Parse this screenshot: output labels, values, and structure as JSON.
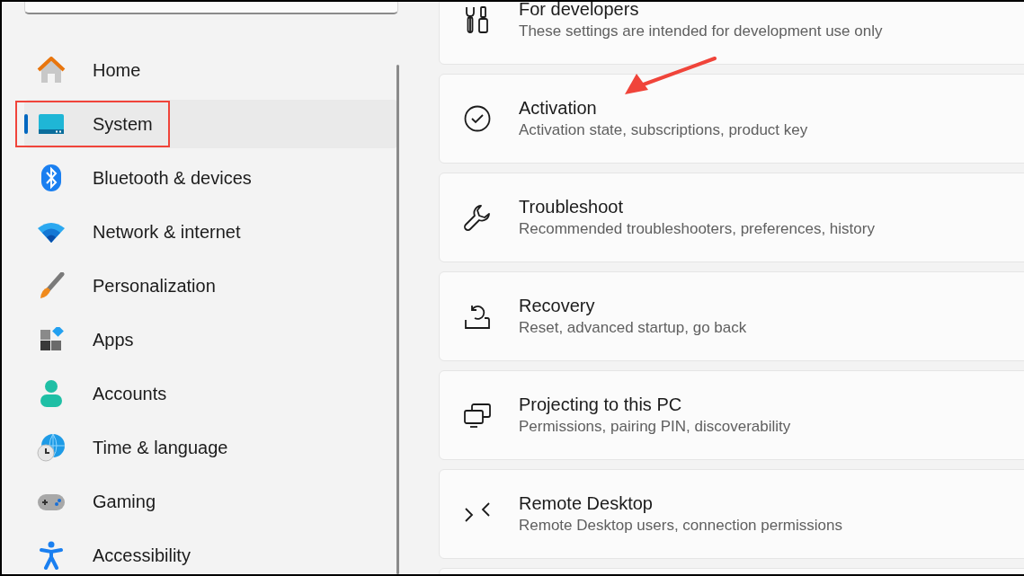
{
  "sidebar": {
    "items": [
      {
        "label": "Home",
        "selected": false,
        "highlighted": false
      },
      {
        "label": "System",
        "selected": true,
        "highlighted": true
      },
      {
        "label": "Bluetooth & devices",
        "selected": false,
        "highlighted": false
      },
      {
        "label": "Network & internet",
        "selected": false,
        "highlighted": false
      },
      {
        "label": "Personalization",
        "selected": false,
        "highlighted": false
      },
      {
        "label": "Apps",
        "selected": false,
        "highlighted": false
      },
      {
        "label": "Accounts",
        "selected": false,
        "highlighted": false
      },
      {
        "label": "Time & language",
        "selected": false,
        "highlighted": false
      },
      {
        "label": "Gaming",
        "selected": false,
        "highlighted": false
      },
      {
        "label": "Accessibility",
        "selected": false,
        "highlighted": false
      }
    ]
  },
  "cards": [
    {
      "title": "For developers",
      "subtitle": "These settings are intended for development use only",
      "pointed": false
    },
    {
      "title": "Activation",
      "subtitle": "Activation state, subscriptions, product key",
      "pointed": true
    },
    {
      "title": "Troubleshoot",
      "subtitle": "Recommended troubleshooters, preferences, history",
      "pointed": false
    },
    {
      "title": "Recovery",
      "subtitle": "Reset, advanced startup, go back",
      "pointed": false
    },
    {
      "title": "Projecting to this PC",
      "subtitle": "Permissions, pairing PIN, discoverability",
      "pointed": false
    },
    {
      "title": "Remote Desktop",
      "subtitle": "Remote Desktop users, connection permissions",
      "pointed": false
    }
  ]
}
